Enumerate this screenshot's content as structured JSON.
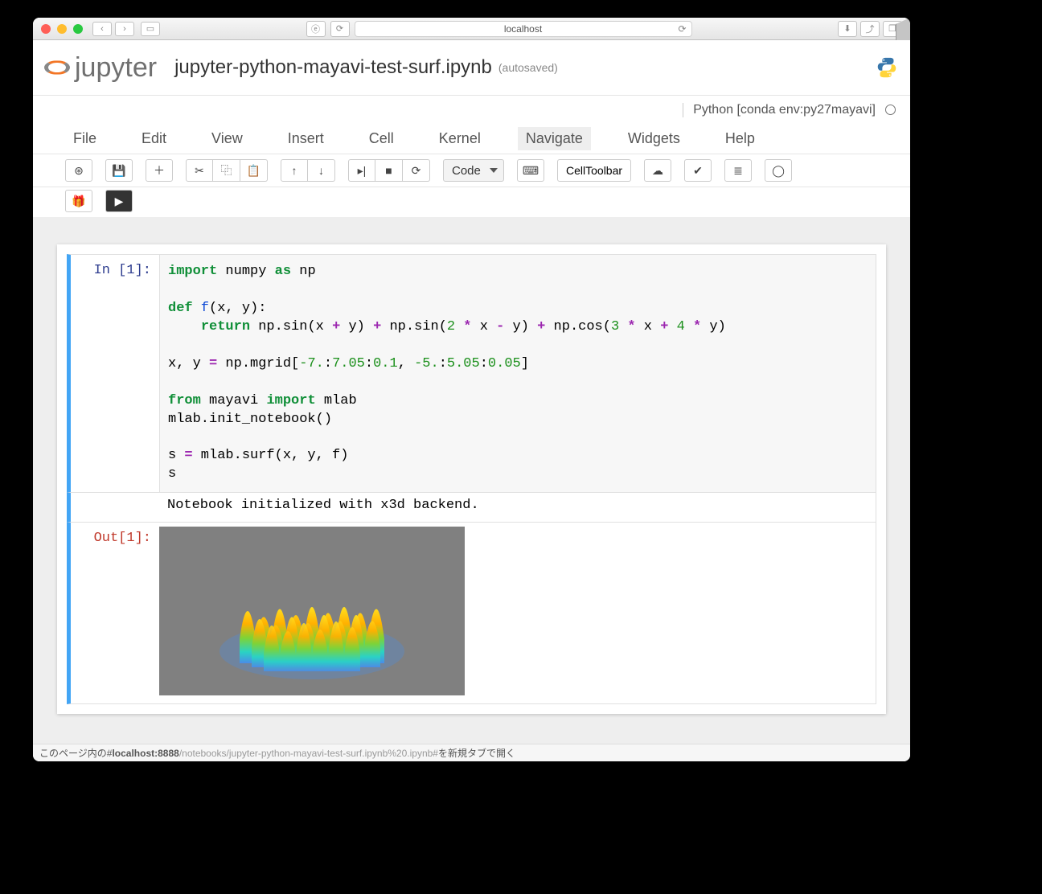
{
  "browser": {
    "url": "localhost",
    "statusbar_prefix": "このページ内の#",
    "statusbar_host": "localhost:8888",
    "statusbar_path": "/notebooks/jupyter-python-mayavi-test-surf.ipynb%20.ipynb#",
    "statusbar_suffix": "を新規タブで開く"
  },
  "header": {
    "logo_text": "jupyter",
    "notebook_name": "jupyter-python-mayavi-test-surf.ipynb",
    "autosave": "(autosaved)"
  },
  "kernel": {
    "display": "Python [conda env:py27mayavi]"
  },
  "menu": {
    "items": [
      "File",
      "Edit",
      "View",
      "Insert",
      "Cell",
      "Kernel",
      "Navigate",
      "Widgets",
      "Help"
    ]
  },
  "toolbar": {
    "cell_type": "Code",
    "cell_toolbar": "CellToolbar"
  },
  "cell1": {
    "in_prompt": "In [1]:",
    "out_prompt": "Out[1]:",
    "output_text": "Notebook initialized with x3d backend.",
    "code": {
      "l1_import": "import",
      "l1_numpy": " numpy ",
      "l1_as": "as",
      "l1_np": " np",
      "l3_def": "def",
      "l3_name": " f",
      "l3_args": "(x, y):",
      "l4_return": "return",
      "l4_a": " np.sin(x ",
      "l4_plus1": "+",
      "l4_b": " y) ",
      "l4_plus2": "+",
      "l4_c": " np.sin(",
      "l4_n2": "2",
      "l4_star1": " * ",
      "l4_d": "x ",
      "l4_minus": "-",
      "l4_e": " y) ",
      "l4_plus3": "+",
      "l4_f": " np.cos(",
      "l4_n3": "3",
      "l4_star2": " * ",
      "l4_g": "x ",
      "l4_plus4": "+",
      "l4_n4": " 4",
      "l4_star3": " * ",
      "l4_h": "y)",
      "l6_a": "x, y ",
      "l6_eq": "=",
      "l6_b": " np.mgrid[",
      "l6_n1": "-7.",
      "l6_colon1": ":",
      "l6_n2": "7.05",
      "l6_colon2": ":",
      "l6_n3": "0.1",
      "l6_comma": ", ",
      "l6_n4": "-5.",
      "l6_colon3": ":",
      "l6_n5": "5.05",
      "l6_colon4": ":",
      "l6_n6": "0.05",
      "l6_close": "]",
      "l8_from": "from",
      "l8_mayavi": " mayavi ",
      "l8_import": "import",
      "l8_mlab": " mlab",
      "l9": "mlab.init_notebook()",
      "l11_a": "s ",
      "l11_eq": "=",
      "l11_b": " mlab.surf(x, y, f)",
      "l12": "s"
    }
  }
}
